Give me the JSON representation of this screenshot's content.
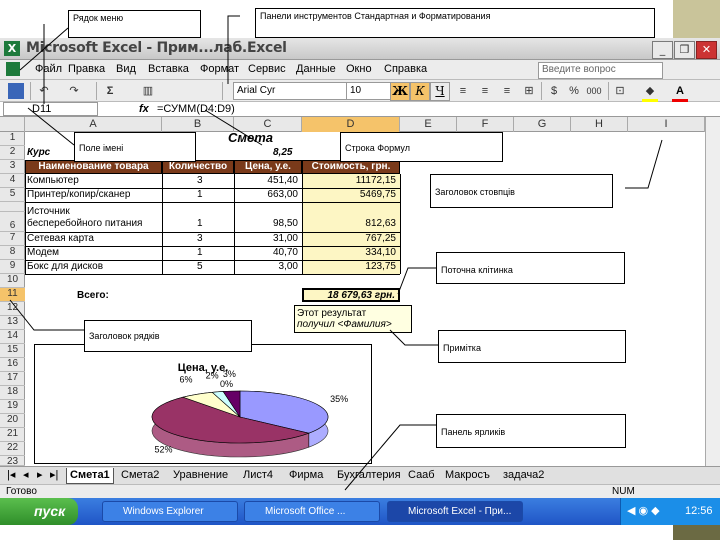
{
  "window": {
    "title": "Microsoft Excel - Прим...лаб.Excel",
    "buttons": {
      "minimize": "_",
      "restore": "❐",
      "close": "✕"
    }
  },
  "menu": {
    "items": [
      "Файл",
      "Правка",
      "Вид",
      "Вставка",
      "Формат",
      "Сервис",
      "Данные",
      "Окно",
      "Справка"
    ],
    "help_placeholder": "Введите вопрос"
  },
  "toolbar": {
    "font": "Arial Cyr",
    "size": "10",
    "bold": "Ж",
    "italic": "К",
    "underline": "Ч"
  },
  "formula_bar": {
    "name_box": "D11",
    "fx": "fx",
    "formula": "=СУММ(D4:D9)"
  },
  "columns": [
    "A",
    "B",
    "C",
    "D",
    "E",
    "F",
    "G",
    "H",
    "I"
  ],
  "rows": [
    "1",
    "2",
    "3",
    "4",
    "5",
    "",
    "6",
    "7",
    "8",
    "9",
    "10",
    "11",
    "12",
    "13",
    "14",
    "15",
    "16",
    "17",
    "18",
    "19",
    "20",
    "21",
    "22",
    "23"
  ],
  "sheet": {
    "title": "Смета",
    "course_label": "Курс",
    "course_value": "8,25",
    "headers": [
      "Наименование товара",
      "Количество",
      "Цена, у.е.",
      "Стоимость, грн."
    ],
    "items": [
      {
        "name": "Компьютер",
        "qty": "3",
        "price": "451,40",
        "cost": "11172,15"
      },
      {
        "name": "Принтер/копир/сканер",
        "qty": "1",
        "price": "663,00",
        "cost": "5469,75"
      },
      {
        "name1": "Источник",
        "name2": "бесперебойного питания",
        "qty": "1",
        "price": "98,50",
        "cost": "812,63"
      },
      {
        "name": "Сетевая карта",
        "qty": "3",
        "price": "31,00",
        "cost": "767,25"
      },
      {
        "name": "Модем",
        "qty": "1",
        "price": "40,70",
        "cost": "334,10"
      },
      {
        "name": "Бокс для дисков",
        "qty": "5",
        "price": "3,00",
        "cost": "123,75"
      }
    ],
    "total_label": "Всего:",
    "total_value": "18 679,63 грн."
  },
  "comment": {
    "line1": "Этот результат",
    "line2": "получил <Фамилия>"
  },
  "chart_data": {
    "type": "pie",
    "title": "Цена, у.е.",
    "categories": [
      "Компьютер",
      "Принтер/копир/сканер",
      "Источник бесперебойного питания",
      "Сетевая карта",
      "Модем",
      "Бокс для дисков"
    ],
    "values": [
      35,
      52,
      6,
      2,
      3,
      0
    ],
    "labels": [
      "35%",
      "52%",
      "6%",
      "2%",
      "3%",
      "0%"
    ]
  },
  "tabs": [
    "Смета1",
    "Смета2",
    "Уравнение",
    "Лист4",
    "Фирма",
    "Бухгалтерия",
    "Сааб",
    "Макросъ",
    "задача2"
  ],
  "status": {
    "left": "Готово",
    "right": "NUM"
  },
  "taskbar": {
    "start": "пуск",
    "tasks": [
      "Windows Explorer",
      "Microsoft Office ...",
      "Microsoft Excel - При..."
    ],
    "clock": "12:56"
  },
  "annotations": {
    "menu_row": "Рядок меню",
    "toolbars": "Панели инструментов Стандартная и Форматирования",
    "name_field": "Поле імені",
    "formula_row": "Строка Формул",
    "col_header": "Заголовок стовпців",
    "current_cell": "Поточна клітинка",
    "row_header": "Заголовок рядків",
    "note": "Примітка",
    "tabs_panel": "Панель ярликів"
  }
}
